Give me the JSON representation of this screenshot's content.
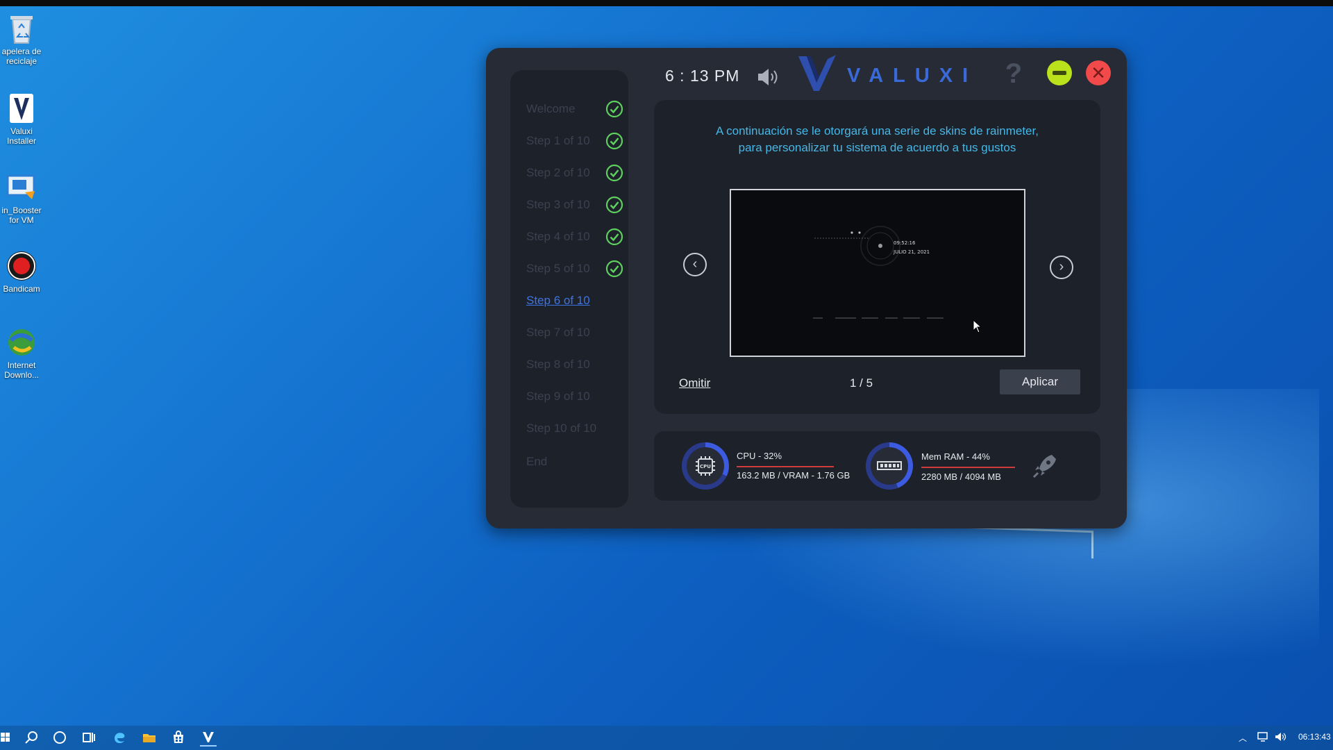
{
  "desktop": {
    "icons": [
      {
        "label": "apelera de\nreciclaje"
      },
      {
        "label": "Valuxi\nInstaller"
      },
      {
        "label": "in_Booster\nfor VM"
      },
      {
        "label": "Bandicam"
      },
      {
        "label": "Internet\nDownlo..."
      }
    ]
  },
  "app": {
    "clock": "6 : 13 PM",
    "brand": "VALUXI",
    "help_glyph": "?",
    "close_glyph": "✕",
    "steps": [
      {
        "label": "Welcome",
        "done": true
      },
      {
        "label": "Step 1 of 10",
        "done": true
      },
      {
        "label": "Step 2 of 10",
        "done": true
      },
      {
        "label": "Step 3 of 10",
        "done": true
      },
      {
        "label": "Step 4 of 10",
        "done": true
      },
      {
        "label": "Step 5 of 10",
        "done": true
      },
      {
        "label": "Step 6 of 10",
        "done": false,
        "current": true
      },
      {
        "label": "Step 7 of 10",
        "done": false
      },
      {
        "label": "Step 8 of 10",
        "done": false
      },
      {
        "label": "Step 9 of 10",
        "done": false
      },
      {
        "label": "Step 10 of 10",
        "done": false
      },
      {
        "label": "End",
        "done": false
      }
    ],
    "description": "A continuación se le otorgará una serie de skins de rainmeter, para personalizar tu sistema de acuerdo a tus gustos",
    "preview": {
      "time": "09:52:16",
      "date": "JULIO 21, 2021"
    },
    "prev_glyph": "‹",
    "next_glyph": "›",
    "skip_label": "Omitir",
    "pager": "1 / 5",
    "apply_label": "Aplicar",
    "stats": {
      "cpu": {
        "title": "CPU - 32%",
        "sub": "163.2 MB / VRAM - 1.76 GB",
        "percent": 32,
        "icon_label": "CPU"
      },
      "ram": {
        "title": "Mem RAM - 44%",
        "sub": "2280 MB / 4094 MB",
        "percent": 44
      }
    }
  },
  "taskbar": {
    "tray_time": "06:13:43"
  },
  "colors": {
    "accent": "#3a6ad8",
    "current_step": "#3d74e6",
    "description_text": "#46b7e6",
    "minimize": "#b9e21c",
    "close": "#f24a4a",
    "check": "#5fcf5f"
  }
}
